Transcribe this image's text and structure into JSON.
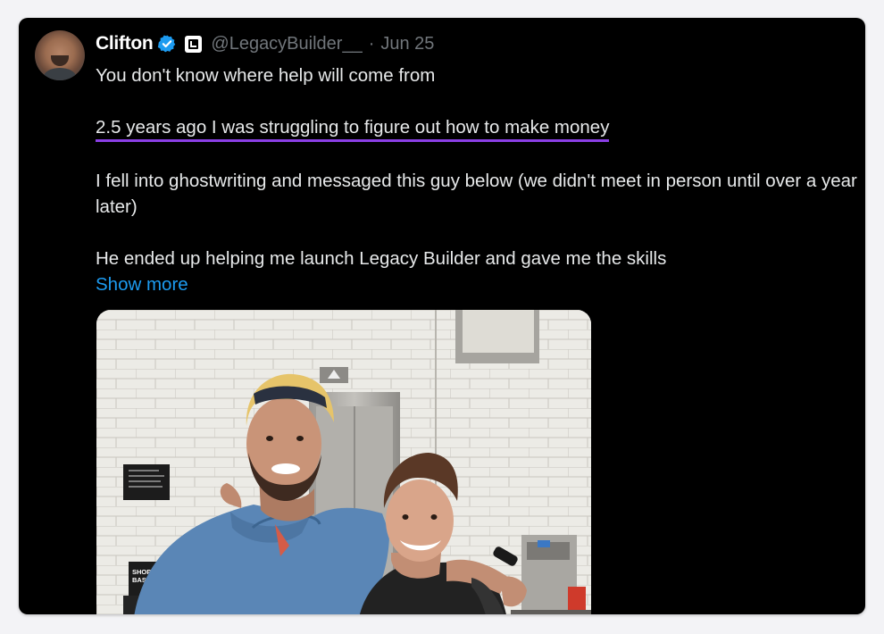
{
  "tweet": {
    "author_name": "Clifton",
    "handle": "@LegacyBuilder__",
    "separator": "·",
    "date": "Jun 25",
    "lines": [
      "You don't know where help will come from",
      "2.5 years ago I was struggling to figure out how to make money",
      "I fell into ghostwriting and messaged this guy below (we didn't meet in person until over a year later)",
      "He ended up helping me launch Legacy Builder and gave me the skills"
    ],
    "show_more": "Show more",
    "photo_signs": {
      "basket_line1": "SHOPPING",
      "basket_line2": "BASKETS"
    }
  },
  "colors": {
    "background": "#000000",
    "text": "#e7e9ea",
    "muted": "#71767b",
    "link": "#1d9bf0",
    "verified": "#1d9bf0",
    "highlight": "#8b3fe6"
  },
  "icons": {
    "verified": "verified-check-icon",
    "affiliate": "legacy-builder-badge-icon"
  }
}
